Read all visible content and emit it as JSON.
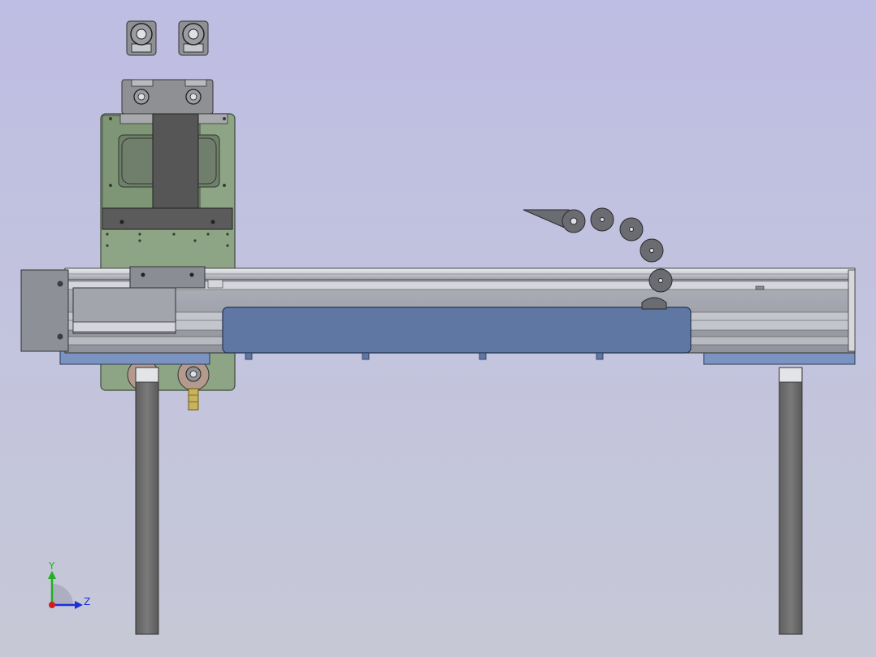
{
  "viewport": {
    "background_top": "#bebde3",
    "background_bottom": "#c6c8d6"
  },
  "colors": {
    "frame_gray": "#6e6e6e",
    "frame_dark": "#555555",
    "rail_light": "#d9dade",
    "rail_mid": "#a9abb2",
    "plate_green": "#8ea585",
    "plate_green_dark": "#718a6a",
    "carriage_blue": "#5e77a3",
    "base_blue": "#7a93c0",
    "bracket_gray": "#8f9094",
    "chain_gray": "#6b6c72",
    "brass": "#c8b25a",
    "axis_y": "#1fb21f",
    "axis_z": "#1d2fd8",
    "axis_x": "#d21d1d"
  },
  "triad": {
    "y_label": "Y",
    "z_label": "Z"
  },
  "icons": {
    "triad": "coordinate-triad-icon"
  }
}
